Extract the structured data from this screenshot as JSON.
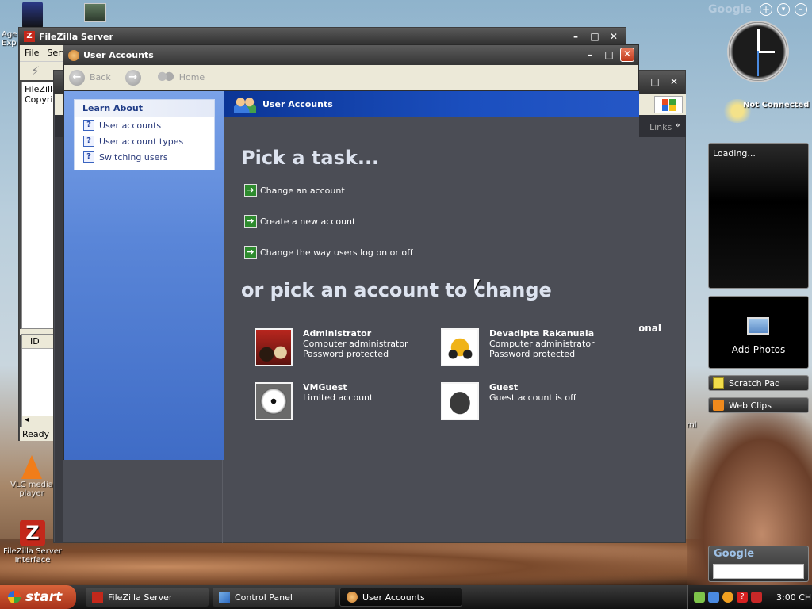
{
  "desktop_icons": [
    {
      "label": "Age\nExp"
    },
    {
      "label": "VLC media\nplayer"
    },
    {
      "label": "FileZilla Server\nInterface"
    }
  ],
  "filezilla": {
    "title": "FileZilla Server",
    "menu": [
      "File",
      "Serv"
    ],
    "log_lines": [
      "FileZilla",
      "Copyrig"
    ],
    "col_id": "ID",
    "status": "Ready"
  },
  "back_window": {
    "links": "Links",
    "partial": "onal",
    "partial2": "ml"
  },
  "user_accounts": {
    "title": "User Accounts",
    "nav": {
      "back": "Back",
      "home": "Home"
    },
    "learn_about": {
      "heading": "Learn About",
      "items": [
        "User accounts",
        "User account types",
        "Switching users"
      ]
    },
    "header": "User Accounts",
    "pick_task": "Pick a task...",
    "tasks": [
      "Change an account",
      "Create a new account",
      "Change the way users log on or off"
    ],
    "pick_account": "or pick an account to change",
    "accounts": [
      {
        "name": "Administrator",
        "line1": "Computer administrator",
        "line2": "Password protected"
      },
      {
        "name": "Devadipta Rakanuala",
        "line1": "Computer administrator",
        "line2": "Password protected"
      },
      {
        "name": "VMGuest",
        "line1": "Limited account",
        "line2": ""
      },
      {
        "name": "Guest",
        "line1": "Guest account is off",
        "line2": ""
      }
    ]
  },
  "sidebar": {
    "google": "Google",
    "status": "Not Connected",
    "loading": "Loading...",
    "add_photos": "Add Photos",
    "scratch_pad": "Scratch Pad",
    "web_clips": "Web Clips",
    "google_search": "Google"
  },
  "taskbar": {
    "start": "start",
    "items": [
      "FileZilla Server",
      "Control Panel",
      "User Accounts"
    ],
    "clock": "3:00 CH"
  },
  "colors": {
    "accent": "#1b4fbf",
    "start": "#c1441f",
    "main_bg": "#4b4d55"
  }
}
